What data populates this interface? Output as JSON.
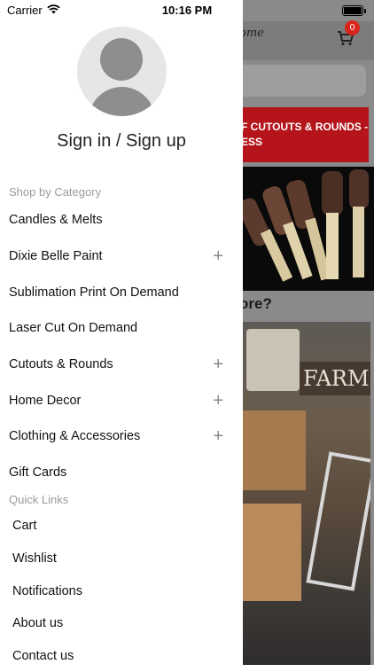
{
  "status_bar": {
    "carrier": "Carrier",
    "time": "10:16 PM",
    "battery_level": 1.0
  },
  "background": {
    "logo_text": "ome",
    "cart_count": "0",
    "banner_text": "F CUTOUTS & ROUNDS - ESS",
    "banner_line1": "F CUTOUTS & ROUNDS -",
    "banner_line2": "ESS",
    "question_text": "ore?",
    "store_sign_text": "FARM",
    "colors": {
      "banner": "#b4141a",
      "badge": "#d9261c"
    }
  },
  "drawer": {
    "sign_in_label": "Sign in / Sign up",
    "shop_section_label": "Shop by Category",
    "categories": [
      {
        "label": "Candles & Melts",
        "expandable": false
      },
      {
        "label": "Dixie Belle Paint",
        "expandable": true
      },
      {
        "label": "Sublimation Print On Demand",
        "expandable": false
      },
      {
        "label": "Laser Cut On Demand",
        "expandable": false
      },
      {
        "label": "Cutouts & Rounds",
        "expandable": true
      },
      {
        "label": "Home Decor",
        "expandable": true
      },
      {
        "label": "Clothing & Accessories",
        "expandable": true
      },
      {
        "label": "Gift Cards",
        "expandable": false
      }
    ],
    "quick_links_label": "Quick Links",
    "quick_links": [
      "Cart",
      "Wishlist",
      "Notifications",
      "About us",
      "Contact us"
    ],
    "expand_icon": "plus-icon"
  }
}
